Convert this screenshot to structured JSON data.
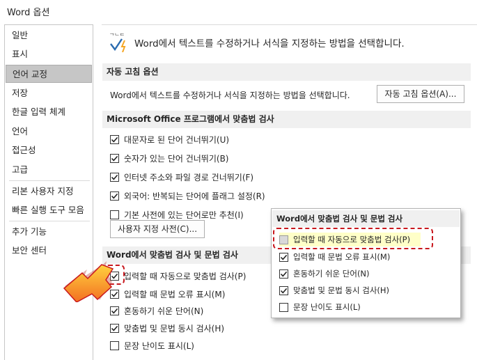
{
  "window": {
    "title": "Word 옵션"
  },
  "sidebar": {
    "items": [
      {
        "label": "일반"
      },
      {
        "label": "표시"
      },
      {
        "label": "언어 교정",
        "active": true
      },
      {
        "label": "저장"
      },
      {
        "label": "한글 입력 체계"
      },
      {
        "label": "언어"
      },
      {
        "label": "접근성"
      },
      {
        "label": "고급"
      },
      {
        "label": "리본 사용자 지정"
      },
      {
        "label": "빠른 실행 도구 모음"
      },
      {
        "label": "추가 기능"
      },
      {
        "label": "보안 센터"
      }
    ]
  },
  "main": {
    "header_text": "Word에서 텍스트를 수정하거나 서식을 지정하는 방법을 선택합니다.",
    "autocorrect": {
      "section_title": "자동 고침 옵션",
      "description": "Word에서 텍스트를 수정하거나 서식을 지정하는 방법을 선택합니다.",
      "button_label": "자동 고침 옵션(A)..."
    },
    "office_spelling": {
      "section_title": "Microsoft Office 프로그램에서 맞춤법 검사",
      "options": [
        {
          "label": "대문자로 된 단어 건너뛰기(U)",
          "checked": true
        },
        {
          "label": "숫자가 있는 단어 건너뛰기(B)",
          "checked": true
        },
        {
          "label": "인터넷 주소와 파일 경로 건너뛰기(F)",
          "checked": true
        },
        {
          "label": "외국어: 반복되는 단어에 플래그 설정(R)",
          "checked": true
        },
        {
          "label": "기본 사전에 있는 단어로만 추천(I)",
          "checked": false
        }
      ],
      "button_label": "사용자 지정 사전(C)..."
    },
    "word_spelling": {
      "section_title": "Word에서 맞춤법 검사 및 문법 검사",
      "options": [
        {
          "label": "입력할 때 자동으로 맞춤법 검사(P)",
          "checked": true
        },
        {
          "label": "입력할 때 문법 오류 표시(M)",
          "checked": true
        },
        {
          "label": "혼동하기 쉬운 단어(N)",
          "checked": true
        },
        {
          "label": "맞춤법 및 문법 동시 검사(H)",
          "checked": true
        },
        {
          "label": "문장 난이도 표시(L)",
          "checked": false
        }
      ]
    }
  },
  "callout": {
    "section_title": "Word에서 맞춤법 검사 및 문법 검사",
    "options": [
      {
        "label": "입력할 때 자동으로 맞춤법 검사(P)",
        "checked": false,
        "highlighted": true
      },
      {
        "label": "입력할 때 문법 오류 표시(M)",
        "checked": true
      },
      {
        "label": "혼동하기 쉬운 단어(N)",
        "checked": true
      },
      {
        "label": "맞춤법 및 문법 동시 검사(H)",
        "checked": true
      },
      {
        "label": "문장 난이도 표시(L)",
        "checked": false
      }
    ]
  },
  "colors": {
    "sidebar_active": "#c6c6c6",
    "section_bg": "#f0f0f0",
    "annotation_red": "#c8181e",
    "arrow_orange": "#f7941d",
    "highlight_yellow": "#ffffc8"
  }
}
